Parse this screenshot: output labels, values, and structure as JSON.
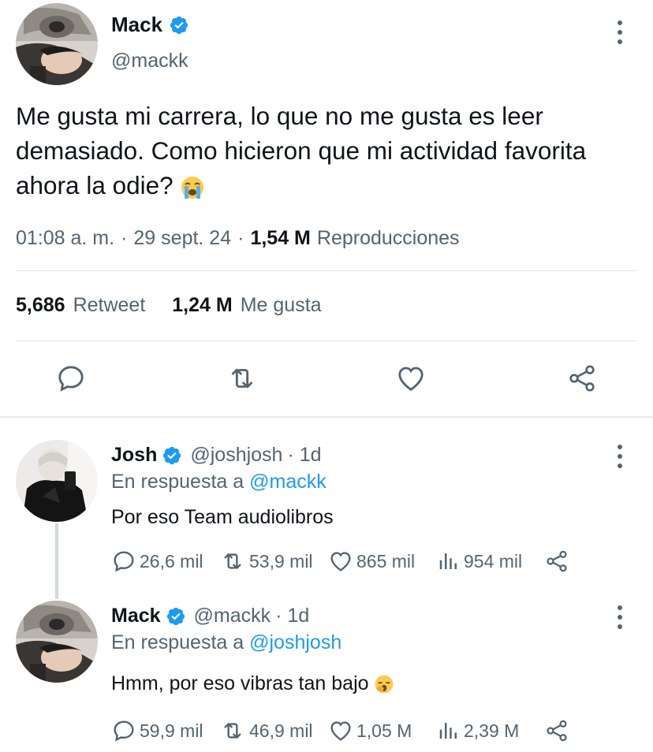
{
  "main_tweet": {
    "author_name": "Mack",
    "author_handle": "@mackk",
    "text": "Me gusta mi carrera, lo que no me gusta es leer demasiado. Como hicieron que mi actividad favorita ahora la odie?",
    "time": "01:08 a. m.",
    "sep1": "·",
    "date": "29 sept. 24",
    "sep2": "·",
    "views_count": "1,54 M",
    "views_label": "Reproducciones",
    "retweets_count": "5,686",
    "retweets_label": "Retweet",
    "likes_count": "1,24 M",
    "likes_label": "Me gusta"
  },
  "replies": [
    {
      "author_name": "Josh",
      "author_handle": "@joshjosh",
      "time": "· 1d",
      "reply_prefix": "En respuesta a",
      "reply_to": "@mackk",
      "text": "Por eso Team audiolibros",
      "replies": "26,6 mil",
      "retweets": "53,9 mil",
      "likes": "865 mil",
      "views": "954 mil"
    },
    {
      "author_name": "Mack",
      "author_handle": "@mackk",
      "time": "· 1d",
      "reply_prefix": "En respuesta a",
      "reply_to": "@joshjosh",
      "text": "Hmm, por eso vibras tan bajo",
      "replies": "59,9 mil",
      "retweets": "46,9 mil",
      "likes": "1,05 M",
      "views": "2,39 M"
    }
  ],
  "colors": {
    "accent": "#1d9bf0",
    "muted": "#536471",
    "text": "#0f1419"
  },
  "icons": [
    "verified-badge-icon",
    "more-icon",
    "reply-icon",
    "retweet-icon",
    "like-icon",
    "share-icon",
    "views-icon",
    "loudly-crying-face-emoji",
    "yawning-face-emoji"
  ]
}
